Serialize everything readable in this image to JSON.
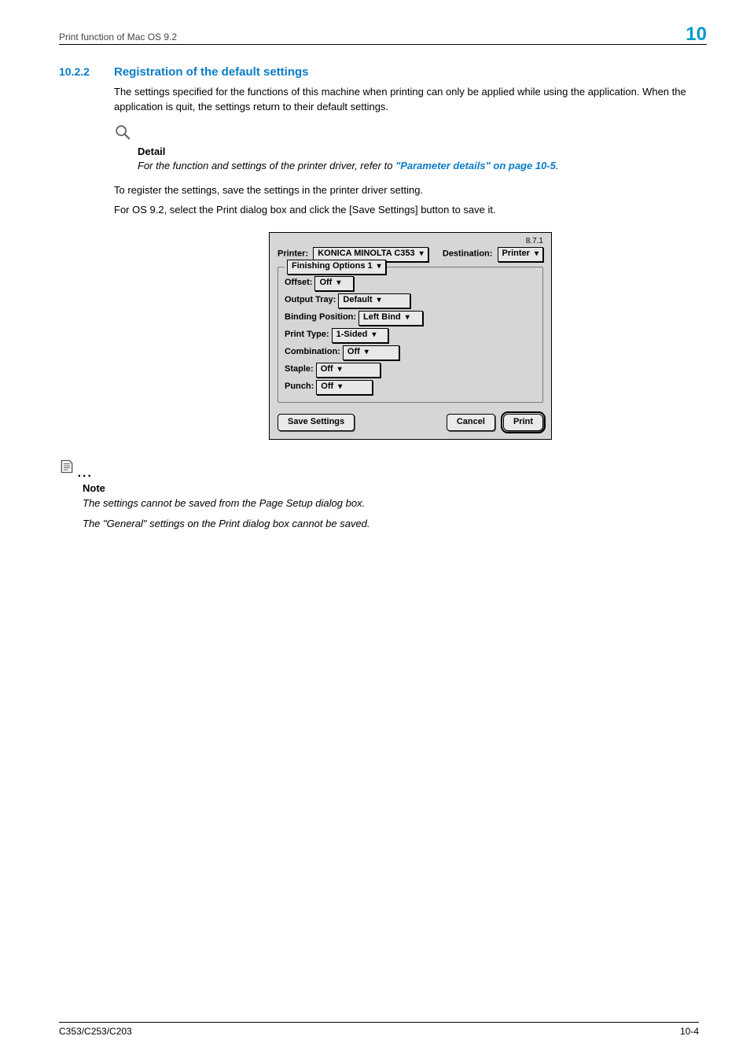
{
  "header": {
    "left": "Print function of Mac OS 9.2",
    "chapter": "10"
  },
  "section": {
    "number": "10.2.2",
    "title": "Registration of the default settings"
  },
  "para1": "The settings specified for the functions of this machine when printing can only be applied while using the application. When the application is quit, the settings return to their default settings.",
  "detail": {
    "heading": "Detail",
    "body_prefix": "For the function and settings of the printer driver, refer to ",
    "link_text": "\"Parameter details\" on page 10-5",
    "body_suffix": "."
  },
  "para2": "To register the settings, save the settings in the printer driver setting.",
  "para3": "For OS 9.2, select the Print dialog box and click the [Save Settings] button to save it.",
  "dialog": {
    "version": "8.7.1",
    "printer_label": "Printer:",
    "printer_value": "KONICA MINOLTA C353",
    "destination_label": "Destination:",
    "destination_value": "Printer",
    "panel_value": "Finishing Options 1",
    "options": [
      {
        "label": "Offset:",
        "value": "Off"
      },
      {
        "label": "Output Tray:",
        "value": "Default"
      },
      {
        "label": "Binding Position:",
        "value": "Left Bind"
      },
      {
        "label": "Print Type:",
        "value": "1-Sided"
      },
      {
        "label": "Combination:",
        "value": "Off"
      },
      {
        "label": "Staple:",
        "value": "Off"
      },
      {
        "label": "Punch:",
        "value": "Off"
      }
    ],
    "save_btn": "Save Settings",
    "cancel_btn": "Cancel",
    "print_btn": "Print"
  },
  "note": {
    "heading": "Note",
    "line1": "The settings cannot be saved from the Page Setup dialog box.",
    "line2": "The \"General\" settings on the Print dialog box cannot be saved."
  },
  "footer": {
    "left": "C353/C253/C203",
    "right": "10-4"
  }
}
